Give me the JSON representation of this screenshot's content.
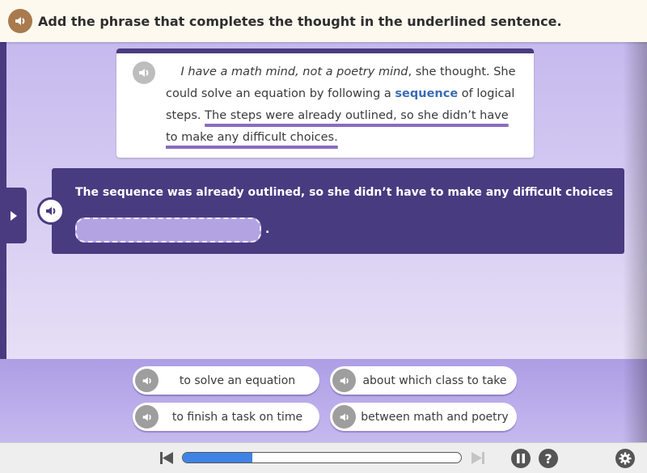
{
  "header": {
    "audio_icon": "speaker-icon",
    "instruction": "Add the phrase that completes the thought in the underlined sentence."
  },
  "passage": {
    "audio_icon": "speaker-icon",
    "italic_part": "I have a math mind, not a poetry mind",
    "part1": ", she thought. She could solve an equation by following a ",
    "vocab_word": "sequence",
    "part2": " of logical steps. ",
    "underlined_sentence": "The steps were already outlined, so she didn’t have to make any difficult choices."
  },
  "question": {
    "audio_icon": "speaker-icon",
    "sentence": "The sequence was already outlined, so she didn’t have to make any difficult choices",
    "blank_value": "",
    "ending_punctuation": "."
  },
  "side_tab": {
    "icon": "play-triangle-icon"
  },
  "choices": [
    {
      "label": "to solve an equation",
      "icon": "speaker-icon"
    },
    {
      "label": "about which class to take",
      "icon": "speaker-icon"
    },
    {
      "label": "to finish a task on time",
      "icon": "speaker-icon"
    },
    {
      "label": "between math and poetry",
      "icon": "speaker-icon"
    }
  ],
  "toolbar": {
    "progress_fraction": 0.25,
    "prev_icon": "skip-back-icon",
    "next_icon": "skip-forward-icon",
    "pause_icon": "pause-icon",
    "help_label": "?",
    "settings_icon": "gear-icon"
  },
  "colors": {
    "accent_purple": "#493b80",
    "vocab_blue": "#3b6ab7",
    "progress_blue": "#3f83e6",
    "header_audio": "#a87a4d"
  }
}
